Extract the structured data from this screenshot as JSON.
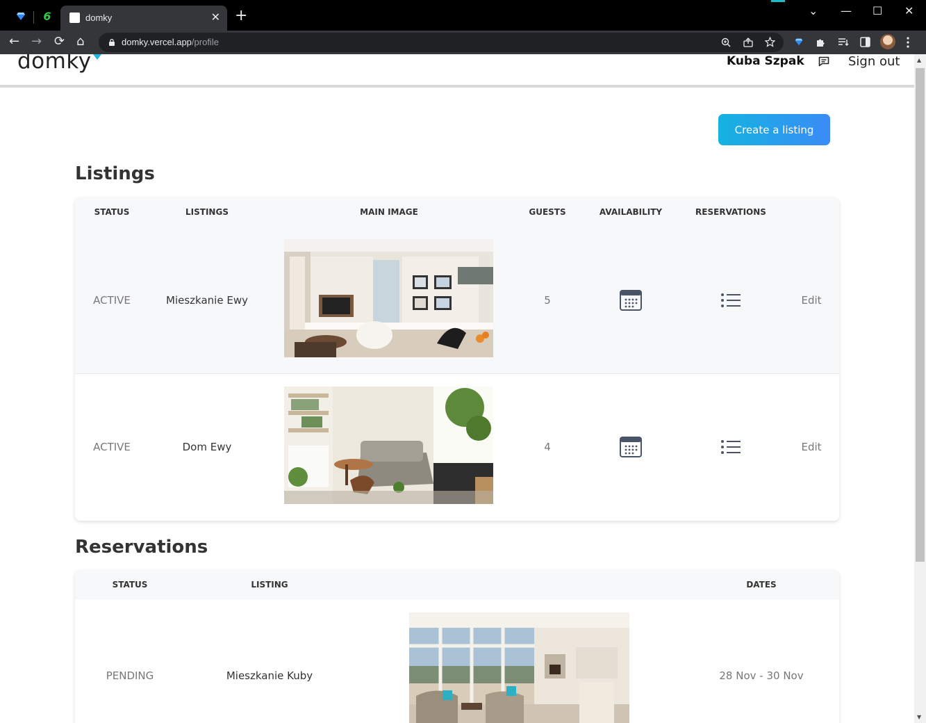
{
  "browser": {
    "tab_title": "domky",
    "close_glyph": "✕",
    "new_tab_glyph": "+",
    "url_host": "domky.vercel.app",
    "url_path": "/profile",
    "controls": {
      "minimize": "—",
      "maximize": "☐",
      "close": "✕",
      "dropdown": "⌄"
    },
    "nav": {
      "back": "←",
      "forward": "→",
      "reload": "⟳",
      "home": "⌂"
    }
  },
  "header": {
    "logo": "domky",
    "user_name": "Kuba Szpak",
    "signout": "Sign out"
  },
  "create_button": "Create a listing",
  "listings": {
    "title": "Listings",
    "columns": [
      "STATUS",
      "LISTINGS",
      "MAIN IMAGE",
      "GUESTS",
      "AVAILABILITY",
      "RESERVATIONS"
    ],
    "rows": [
      {
        "status": "ACTIVE",
        "name": "Mieszkanie Ewy",
        "guests": "5",
        "edit": "Edit",
        "image": "living-room-tv-wall"
      },
      {
        "status": "ACTIVE",
        "name": "Dom Ewy",
        "guests": "4",
        "edit": "Edit",
        "image": "living-room-plants"
      }
    ]
  },
  "reservations": {
    "title": "Reservations",
    "columns": [
      "STATUS",
      "LISTING",
      "DATES"
    ],
    "rows": [
      {
        "status": "PENDING",
        "listing": "Mieszkanie Kuby",
        "dates": "28 Nov - 30 Nov",
        "image": "apartment-bay-windows"
      }
    ]
  },
  "colors": {
    "accent_start": "#14b3e0",
    "accent_end": "#3b8bf7",
    "table_header_bg": "#f7f8fa",
    "chrome_dark": "#35363a"
  }
}
